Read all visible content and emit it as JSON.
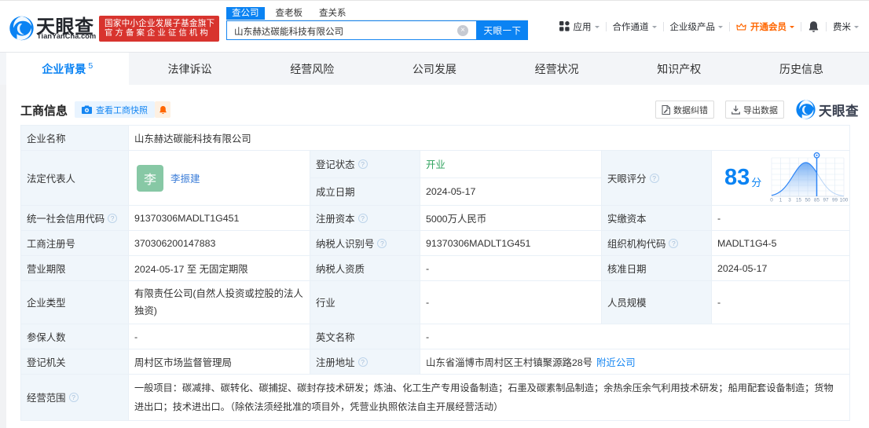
{
  "header": {
    "logo": {
      "brand": "天眼查",
      "domain": "TianYanCha.com"
    },
    "badge": {
      "line1": "国家中小企业发展子基金旗下",
      "line2": "官方备案企业征信机构"
    },
    "search": {
      "tab_company": "查公司",
      "tab_boss": "查老板",
      "tab_relation": "查关系",
      "value": "山东赫达碳能科技有限公司",
      "clear": "×",
      "button": "天眼一下"
    },
    "menu": {
      "apps": "应用",
      "coop": "合作通道",
      "enterprise": "企业级产品",
      "vip": "开通会员",
      "user": "费米"
    }
  },
  "nav": {
    "tabs": [
      {
        "label": "企业背景",
        "badge": "5"
      },
      {
        "label": "法律诉讼"
      },
      {
        "label": "经营风险"
      },
      {
        "label": "公司发展"
      },
      {
        "label": "经营状况"
      },
      {
        "label": "知识产权"
      },
      {
        "label": "历史信息"
      }
    ]
  },
  "section": {
    "title": "工商信息",
    "snapshot_button": "查看工商快照",
    "correction_button": "数据纠错",
    "export_button": "导出数据",
    "watermark": "天眼查"
  },
  "score": {
    "label": "天眼评分",
    "value": "83",
    "unit": "分",
    "axis_labels": [
      "0",
      "1",
      "3",
      "15",
      "50",
      "85",
      "97",
      "99",
      "100"
    ]
  },
  "chart_data": {
    "type": "area",
    "title": "天眼评分分布曲线",
    "x_tick_labels": [
      "0",
      "1",
      "3",
      "15",
      "50",
      "85",
      "97",
      "99",
      "100"
    ],
    "marker_value": 83,
    "marker_tick": "85",
    "shape": "bell-curve filled to marker at 85"
  },
  "table": {
    "company_name_label": "企业名称",
    "company_name": "山东赫达碳能科技有限公司",
    "legal_rep_label": "法定代表人",
    "legal_rep_avatar": "李",
    "legal_rep_name": "李振建",
    "reg_status_label": "登记状态",
    "reg_status": "开业",
    "est_date_label": "成立日期",
    "est_date": "2024-05-17",
    "credit_code_label": "统一社会信用代码",
    "credit_code": "91370306MADLT1G451",
    "reg_capital_label": "注册资本",
    "reg_capital": "5000万人民币",
    "paid_capital_label": "实缴资本",
    "paid_capital": "-",
    "reg_number_label": "工商注册号",
    "reg_number": "370306200147883",
    "taxpayer_id_label": "纳税人识别号",
    "taxpayer_id": "91370306MADLT1G451",
    "org_code_label": "组织机构代码",
    "org_code": "MADLT1G4-5",
    "business_term_label": "营业期限",
    "business_term": "2024-05-17 至 无固定期限",
    "taxpayer_quali_label": "纳税人资质",
    "taxpayer_quali": "-",
    "approval_date_label": "核准日期",
    "approval_date": "2024-05-17",
    "company_type_label": "企业类型",
    "company_type": "有限责任公司(自然人投资或控股的法人独资)",
    "industry_label": "行业",
    "industry": "-",
    "staff_size_label": "人员规模",
    "staff_size": "-",
    "insured_label": "参保人数",
    "insured": "-",
    "english_name_label": "英文名称",
    "english_name": "-",
    "reg_authority_label": "登记机关",
    "reg_authority": "周村区市场监督管理局",
    "reg_address_label": "注册地址",
    "reg_address": "山东省淄博市周村区王村镇聚源路28号",
    "nearby_link": "附近公司",
    "business_scope_label": "经营范围",
    "business_scope": "一般项目：碳减排、碳转化、碳捕捉、碳封存技术研发；炼油、化工生产专用设备制造；石墨及碳素制品制造；余热余压余气利用技术研发；船用配套设备制造；货物进出口；技术进出口。（除依法须经批准的项目外，凭营业执照依法自主开展经营活动）",
    "help": "?"
  },
  "colors": {
    "primary": "#0b83f3",
    "red_badge": "#d8342e",
    "orange": "#ff6600",
    "green_status": "#2fa25e",
    "label_bg": "#f0f6fb"
  }
}
